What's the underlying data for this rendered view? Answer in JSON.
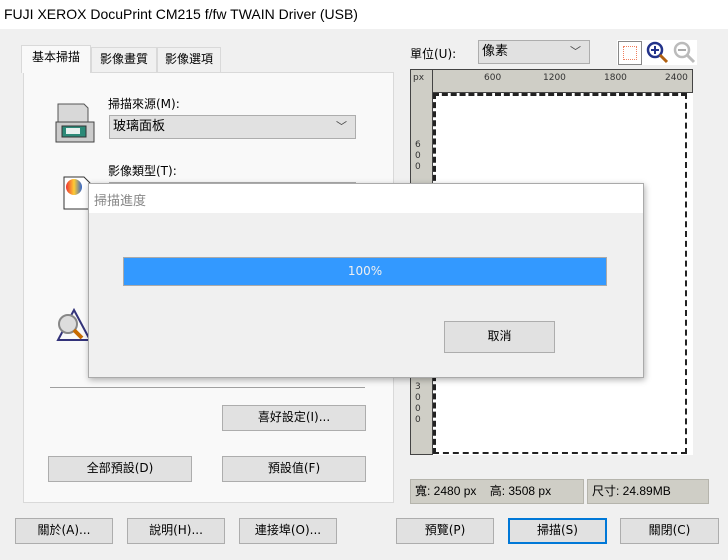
{
  "window": {
    "title": "FUJI XEROX DocuPrint CM215 f/fw TWAIN Driver (USB)"
  },
  "tabs": [
    {
      "label": "基本掃描",
      "active": true
    },
    {
      "label": "影像畫質"
    },
    {
      "label": "影像選項"
    }
  ],
  "basic": {
    "source_label": "掃描來源(M):",
    "source_value": "玻璃面板",
    "type_label": "影像類型(T):",
    "preferences_button": "喜好設定(I)...",
    "all_defaults_button": "全部預設(D)",
    "defaults_button": "預設值(F)"
  },
  "preview": {
    "unit_label": "單位(U):",
    "unit_value": "像素",
    "ruler_unit": "px",
    "top_ticks": [
      "600",
      "1200",
      "1800",
      "2400"
    ],
    "left_ticks": [
      "600",
      "3000"
    ],
    "width": "寬: 2480 px",
    "height": "高: 3508 px",
    "size": "尺寸: 24.89MB"
  },
  "footer": {
    "about": "關於(A)...",
    "help": "說明(H)...",
    "port": "連接埠(O)...",
    "preview": "預覽(P)",
    "scan": "掃描(S)",
    "close": "關閉(C)"
  },
  "progress_dialog": {
    "title": "掃描進度",
    "percent_label": "100%",
    "progress": 100,
    "cancel": "取消",
    "bar_color": "#3399ff"
  }
}
